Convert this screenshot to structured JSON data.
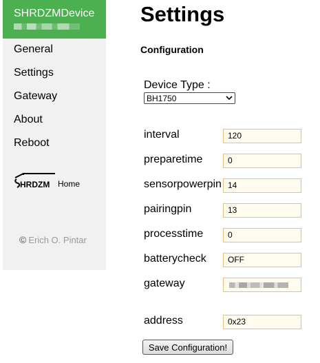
{
  "sidebar": {
    "brand": {
      "title": "SHRDZMDevice",
      "subtitle_redacted": true,
      "color": "#4caf50"
    },
    "items": [
      {
        "label": "General"
      },
      {
        "label": "Settings"
      },
      {
        "label": "Gateway"
      },
      {
        "label": "About"
      },
      {
        "label": "Reboot"
      }
    ],
    "logo": {
      "text": "HRDZM",
      "icon": "shrdzm-logo-icon"
    },
    "home_link": "Home",
    "copyright": {
      "symbol": "©",
      "author": "Erich O. Pintar"
    }
  },
  "main": {
    "title": "Settings",
    "section": "Configuration",
    "device_type": {
      "label": "Device Type :",
      "selected": "BH1750"
    },
    "fields": [
      {
        "label": "interval",
        "value": "120"
      },
      {
        "label": "preparetime",
        "value": "0"
      },
      {
        "label": "sensorpowerpin",
        "value": "14"
      },
      {
        "label": "pairingpin",
        "value": "13"
      },
      {
        "label": "processtime",
        "value": "0"
      },
      {
        "label": "batterycheck",
        "value": "OFF"
      },
      {
        "label": "gateway",
        "value": "",
        "redacted": true
      },
      {
        "label": "address",
        "value": "0x23"
      }
    ],
    "save_label": "Save Configuration!"
  },
  "colors": {
    "accent": "#4caf50",
    "sidebar_bg": "#f1f1f1",
    "input_border": "#e6c27a",
    "input_bg": "#fffbee"
  }
}
